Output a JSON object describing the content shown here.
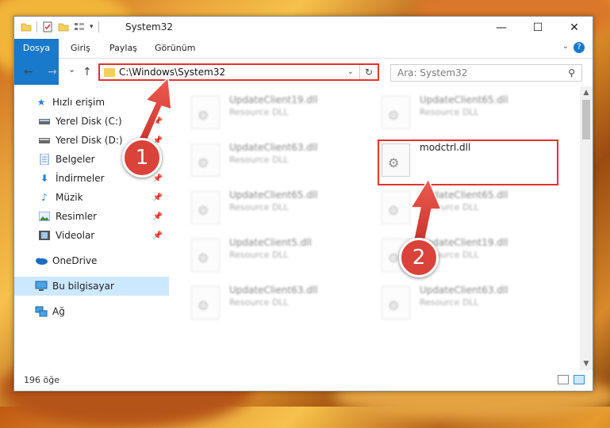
{
  "window": {
    "title": "System32",
    "minimize_glyph": "—",
    "maximize_glyph": "☐",
    "close_glyph": "✕"
  },
  "ribbon": {
    "tabs": [
      "Dosya",
      "Giriş",
      "Paylaş",
      "Görünüm"
    ]
  },
  "nav": {
    "back_glyph": "←",
    "forward_glyph": "→",
    "recent_glyph": "⌄",
    "up_glyph": "↑",
    "address": "C:\\Windows\\System32",
    "refresh_glyph": "↻",
    "search_placeholder": "Ara: System32"
  },
  "sidebar": {
    "items": [
      {
        "label": "Hızlı erişim",
        "icon": "star-icon"
      },
      {
        "label": "Yerel Disk (C:)",
        "icon": "drive-icon",
        "pinned": true
      },
      {
        "label": "Yerel Disk (D:)",
        "icon": "drive-icon",
        "pinned": true
      },
      {
        "label": "Belgeler",
        "icon": "documents-icon",
        "pinned": true
      },
      {
        "label": "İndirmeler",
        "icon": "download-icon",
        "pinned": true
      },
      {
        "label": "Müzik",
        "icon": "music-icon",
        "pinned": true
      },
      {
        "label": "Resimler",
        "icon": "pictures-icon",
        "pinned": true
      },
      {
        "label": "Videolar",
        "icon": "video-icon",
        "pinned": true
      },
      {
        "label": "OneDrive",
        "icon": "cloud-icon"
      },
      {
        "label": "Bu bilgisayar",
        "icon": "computer-icon",
        "selected": true
      },
      {
        "label": "Ağ",
        "icon": "network-icon"
      }
    ]
  },
  "files": [
    {
      "name": "UpdateClient19.dll",
      "type": "Resource DLL",
      "blurred": true
    },
    {
      "name": "UpdateClient65.dll",
      "type": "Resource DLL",
      "blurred": true
    },
    {
      "name": "UpdateClient63.dll",
      "type": "Resource DLL",
      "blurred": true
    },
    {
      "name": "modctrl.dll",
      "type": "",
      "blurred": false
    },
    {
      "name": "UpdateClient65.dll",
      "type": "Resource DLL",
      "blurred": true
    },
    {
      "name": "UpdateClient65.dll",
      "type": "Resource DLL",
      "blurred": true
    },
    {
      "name": "UpdateClient5.dll",
      "type": "Resource DLL",
      "blurred": true
    },
    {
      "name": "UpdateClient19.dll",
      "type": "Resource DLL",
      "blurred": true
    },
    {
      "name": "UpdateClient63.dll",
      "type": "Resource DLL",
      "blurred": true
    },
    {
      "name": "UpdateClient63.dll",
      "type": "Resource DLL",
      "blurred": true
    }
  ],
  "status": {
    "count": "196 öğe"
  },
  "annotations": {
    "badge1": "1",
    "badge2": "2"
  },
  "colors": {
    "accent": "#1979ca",
    "highlight_red": "#e5312f",
    "badge_red": "#d9433a",
    "selected_bg": "#cce8ff"
  }
}
